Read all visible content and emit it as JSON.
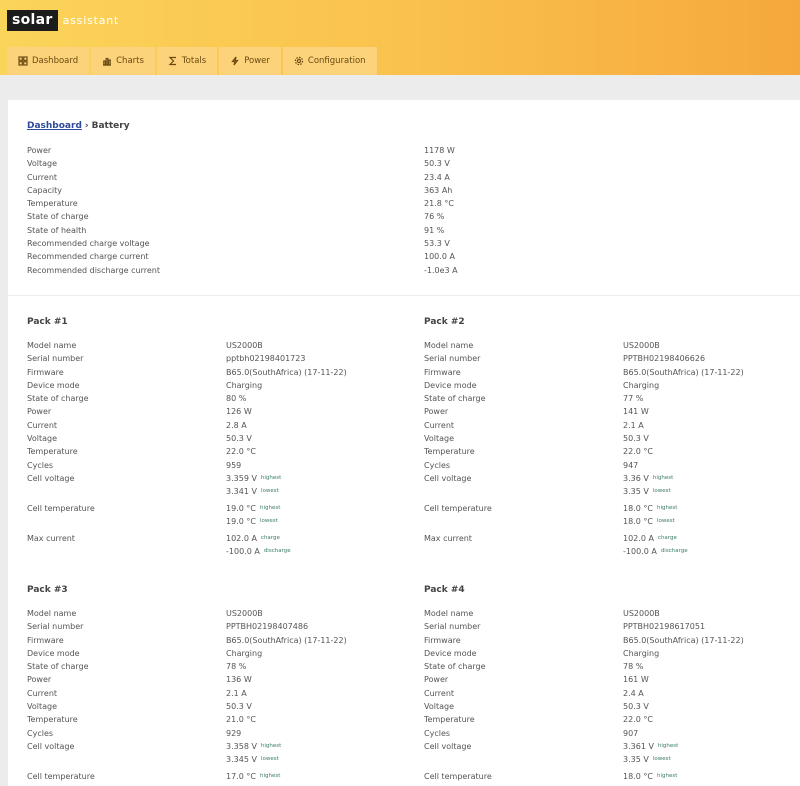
{
  "brand": {
    "name_part1": "solar",
    "name_part2": "assistant"
  },
  "nav": [
    {
      "label": "Dashboard",
      "icon": "dashboard-icon"
    },
    {
      "label": "Charts",
      "icon": "chart-icon"
    },
    {
      "label": "Totals",
      "icon": "sum-icon"
    },
    {
      "label": "Power",
      "icon": "bolt-icon"
    },
    {
      "label": "Configuration",
      "icon": "gear-icon"
    }
  ],
  "breadcrumb": {
    "parent": "Dashboard",
    "separator": "›",
    "current": "Battery"
  },
  "battery": [
    {
      "label": "Power",
      "value": "1178 W"
    },
    {
      "label": "Voltage",
      "value": "50.3 V"
    },
    {
      "label": "Current",
      "value": "23.4 A"
    },
    {
      "label": "Capacity",
      "value": "363 Ah"
    },
    {
      "label": "Temperature",
      "value": "21.8 °C"
    },
    {
      "label": "State of charge",
      "value": "76 %"
    },
    {
      "label": "State of health",
      "value": "91 %"
    },
    {
      "label": "Recommended charge voltage",
      "value": "53.3 V"
    },
    {
      "label": "Recommended charge current",
      "value": "100.0 A"
    },
    {
      "label": "Recommended discharge current",
      "value": "-1.0e3 A"
    }
  ],
  "labels": {
    "model": "Model name",
    "serial": "Serial number",
    "firmware": "Firmware",
    "mode": "Device mode",
    "soc": "State of charge",
    "power": "Power",
    "current": "Current",
    "voltage": "Voltage",
    "temperature": "Temperature",
    "cycles": "Cycles",
    "cell_voltage": "Cell voltage",
    "cell_temperature": "Cell temperature",
    "max_current": "Max current",
    "highest": "highest",
    "lowest": "lowest",
    "charge": "charge",
    "discharge": "discharge"
  },
  "packs": [
    {
      "title": "Pack #1",
      "model": "US2000B",
      "serial": "pptbh02198401723",
      "firmware": "B65.0(SouthAfrica) (17-11-22)",
      "mode": "Charging",
      "soc": "80 %",
      "power": "126 W",
      "current": "2.8 A",
      "voltage": "50.3 V",
      "temperature": "22.0 °C",
      "cycles": "959",
      "cell_voltage_high": "3.359 V",
      "cell_voltage_low": "3.341 V",
      "cell_temp_high": "19.0 °C",
      "cell_temp_low": "19.0 °C",
      "max_charge": "102.0 A",
      "max_discharge": "-100.0 A"
    },
    {
      "title": "Pack #2",
      "model": "US2000B",
      "serial": "PPTBH02198406626",
      "firmware": "B65.0(SouthAfrica) (17-11-22)",
      "mode": "Charging",
      "soc": "77 %",
      "power": "141 W",
      "current": "2.1 A",
      "voltage": "50.3 V",
      "temperature": "22.0 °C",
      "cycles": "947",
      "cell_voltage_high": "3.36 V",
      "cell_voltage_low": "3.35 V",
      "cell_temp_high": "18.0 °C",
      "cell_temp_low": "18.0 °C",
      "max_charge": "102.0 A",
      "max_discharge": "-100.0 A"
    },
    {
      "title": "Pack #3",
      "model": "US2000B",
      "serial": "PPTBH02198407486",
      "firmware": "B65.0(SouthAfrica) (17-11-22)",
      "mode": "Charging",
      "soc": "78 %",
      "power": "136 W",
      "current": "2.1 A",
      "voltage": "50.3 V",
      "temperature": "21.0 °C",
      "cycles": "929",
      "cell_voltage_high": "3.358 V",
      "cell_voltage_low": "3.345 V",
      "cell_temp_high": "17.0 °C"
    },
    {
      "title": "Pack #4",
      "model": "US2000B",
      "serial": "PPTBH02198617051",
      "firmware": "B65.0(SouthAfrica) (17-11-22)",
      "mode": "Charging",
      "soc": "78 %",
      "power": "161 W",
      "current": "2.4 A",
      "voltage": "50.3 V",
      "temperature": "22.0 °C",
      "cycles": "907",
      "cell_voltage_high": "3.361 V",
      "cell_voltage_low": "3.35 V",
      "cell_temp_high": "18.0 °C"
    }
  ]
}
